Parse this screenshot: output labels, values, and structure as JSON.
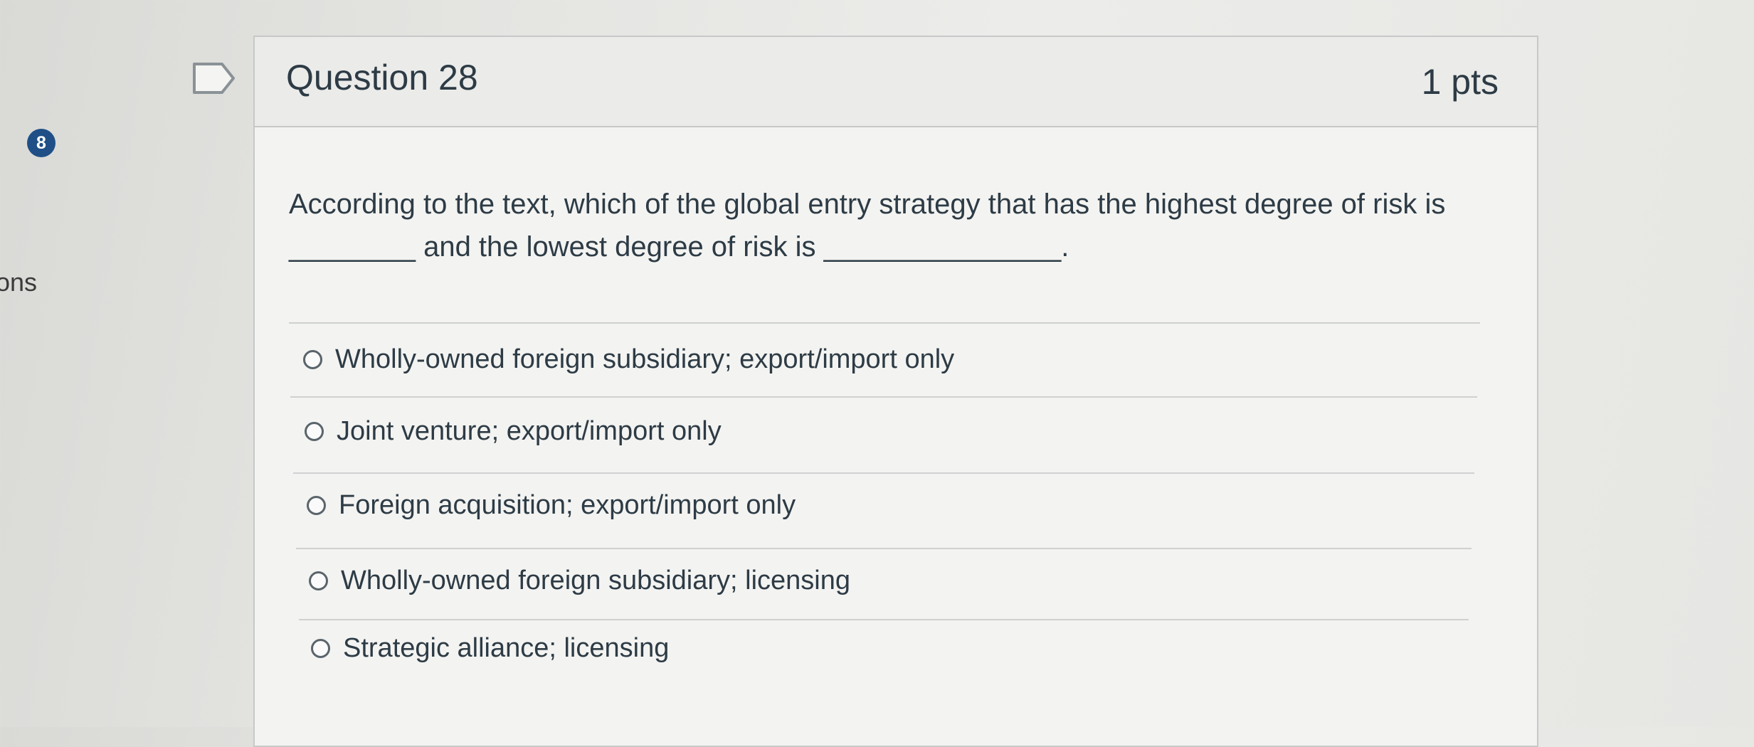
{
  "sidebar": {
    "badge_count": "8",
    "partial_label": "ons"
  },
  "question": {
    "title": "Question 28",
    "points": "1 pts",
    "text": "According to the text, which of the global entry strategy that has the highest degree of risk is ________ and the lowest degree of risk is _______________.",
    "answers": [
      "Wholly-owned foreign subsidiary; export/import only",
      "Joint venture; export/import only",
      "Foreign acquisition; export/import only",
      "Wholly-owned foreign subsidiary; licensing",
      "Strategic alliance; licensing"
    ]
  },
  "icons": {
    "flag": "flag-outline-icon",
    "radio": "radio-unchecked-icon"
  },
  "colors": {
    "badge": "#1f4f86",
    "text": "#2d3b45",
    "border": "#c7c9c8"
  }
}
